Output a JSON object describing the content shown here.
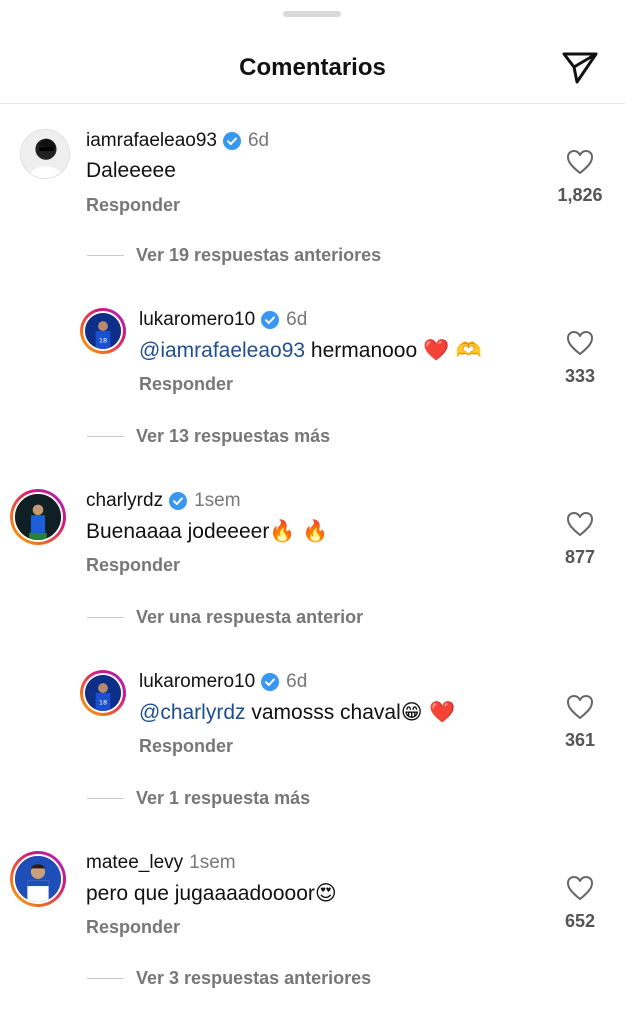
{
  "header": {
    "title": "Comentarios",
    "share_icon": "paper-plane-icon"
  },
  "comments": [
    {
      "username": "iamrafaeleao93",
      "verified": true,
      "time": "6d",
      "text": "Daleeeee",
      "reply_label": "Responder",
      "likes": "1,826",
      "thread_label": "Ver 19 respuestas anteriores"
    },
    {
      "username": "lukaromero10",
      "verified": true,
      "time": "6d",
      "mention": "@iamrafaeleao93",
      "text": " hermanooo ",
      "emojis": "❤️ 🫶",
      "reply_label": "Responder",
      "likes": "333",
      "thread_label": "Ver 13 respuestas más"
    },
    {
      "username": "charlyrdz",
      "verified": true,
      "time": "1sem",
      "text": "Buenaaaa jodeeeer",
      "emojis": "🔥 🔥",
      "reply_label": "Responder",
      "likes": "877",
      "thread_label": "Ver una respuesta anterior"
    },
    {
      "username": "lukaromero10",
      "verified": true,
      "time": "6d",
      "mention": "@charlyrdz",
      "text": " vamosss chaval",
      "emojis": "😁 ❤️",
      "reply_label": "Responder",
      "likes": "361",
      "thread_label": "Ver 1 respuesta más"
    },
    {
      "username": "matee_levy",
      "verified": false,
      "time": "1sem",
      "text": "pero que jugaaaadoooor",
      "emojis": "😍",
      "reply_label": "Responder",
      "likes": "652",
      "thread_label": "Ver 3 respuestas anteriores"
    }
  ],
  "colors": {
    "mention": "#1f4f8f",
    "verified": "#3897f0",
    "secondary_text": "#777777",
    "heart_emoji": "#e0243c"
  }
}
